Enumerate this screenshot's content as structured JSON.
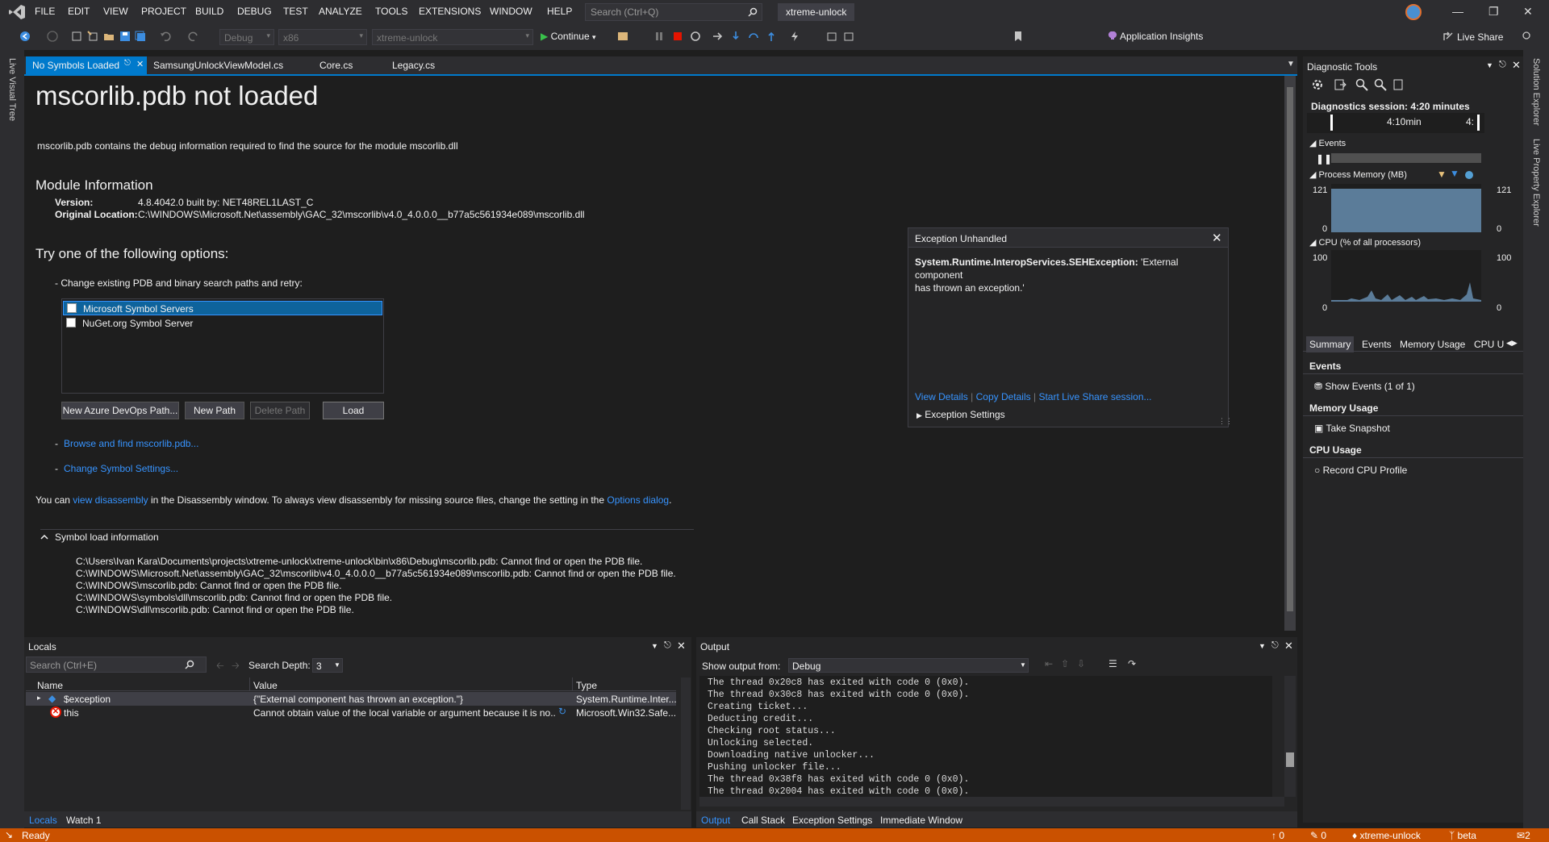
{
  "menu": [
    "FILE",
    "EDIT",
    "VIEW",
    "PROJECT",
    "BUILD",
    "DEBUG",
    "TEST",
    "ANALYZE",
    "TOOLS",
    "EXTENSIONS",
    "WINDOW",
    "HELP"
  ],
  "search_placeholder": "Search (Ctrl+Q)",
  "solution_name": "xtreme-unlock",
  "toolbar": {
    "config": "Debug",
    "platform": "x86",
    "startup": "xtreme-unlock",
    "continue_label": "Continue",
    "app_insights": "Application Insights",
    "live_share": "Live Share"
  },
  "left_strip": "Live Visual Tree",
  "right_strip": [
    "Solution Explorer",
    "Live Property Explorer"
  ],
  "tabs": [
    {
      "label": "No Symbols Loaded"
    },
    {
      "label": "SamsungUnlockViewModel.cs"
    },
    {
      "label": "Core.cs"
    },
    {
      "label": "Legacy.cs"
    }
  ],
  "doc": {
    "title": "mscorlib.pdb not loaded",
    "description": "mscorlib.pdb contains the debug information required to find the source for the module mscorlib.dll",
    "module_heading": "Module Information",
    "version_label": "Version:",
    "version_value": "4.8.4042.0 built by: NET48REL1LAST_C",
    "location_label": "Original Location:",
    "location_value": "C:\\WINDOWS\\Microsoft.Net\\assembly\\GAC_32\\mscorlib\\v4.0_4.0.0.0__b77a5c561934e089\\mscorlib.dll",
    "options_heading": "Try one of the following options:",
    "option_change": "- Change existing PDB and binary search paths and retry:",
    "servers": [
      "Microsoft Symbol Servers",
      "NuGet.org Symbol Server"
    ],
    "buttons": {
      "azure": "New Azure DevOps Path...",
      "new_path": "New Path",
      "delete_path": "Delete Path",
      "load": "Load"
    },
    "browse_dash": "-",
    "browse_link": "Browse and find mscorlib.pdb...",
    "settings_dash": "-",
    "settings_link": "Change Symbol Settings...",
    "disasm_pre": "You can ",
    "disasm_link": "view disassembly",
    "disasm_mid": " in the Disassembly window. To always view disassembly for missing source files, change the setting in the ",
    "disasm_link2": "Options dialog",
    "disasm_post": ".",
    "symbol_heading": "Symbol load information",
    "symbol_lines": [
      "C:\\Users\\Ivan Kara\\Documents\\projects\\xtreme-unlock\\xtreme-unlock\\bin\\x86\\Debug\\mscorlib.pdb: Cannot find or open the PDB file.",
      "C:\\WINDOWS\\Microsoft.Net\\assembly\\GAC_32\\mscorlib\\v4.0_4.0.0.0__b77a5c561934e089\\mscorlib.pdb: Cannot find or open the PDB file.",
      "C:\\WINDOWS\\mscorlib.pdb: Cannot find or open the PDB file.",
      "C:\\WINDOWS\\symbols\\dll\\mscorlib.pdb: Cannot find or open the PDB file.",
      "C:\\WINDOWS\\dll\\mscorlib.pdb: Cannot find or open the PDB file."
    ]
  },
  "exception": {
    "title": "Exception Unhandled",
    "type": "System.Runtime.InteropServices.SEHException:",
    "message_a": " 'External component",
    "message_b": "has thrown an exception.'",
    "links": [
      "View Details",
      "Copy Details",
      "Start Live Share session..."
    ],
    "settings": "Exception Settings"
  },
  "diag": {
    "title": "Diagnostic Tools",
    "session": "Diagnostics session: 4:20 minutes",
    "timeline_a": "4:10min",
    "timeline_b": "4:",
    "events_label": "Events",
    "memory_label": "Process Memory (MB)",
    "mem_max": "121",
    "mem_min": "0",
    "cpu_label": "CPU (% of all processors)",
    "cpu_max": "100",
    "cpu_min": "0",
    "tabs": [
      "Summary",
      "Events",
      "Memory Usage",
      "CPU U"
    ],
    "sections": [
      {
        "heading": "Events",
        "action": "Show Events (1 of 1)"
      },
      {
        "heading": "Memory Usage",
        "action": "Take Snapshot"
      },
      {
        "heading": "CPU Usage",
        "action": "Record CPU Profile"
      }
    ]
  },
  "locals": {
    "title": "Locals",
    "search_placeholder": "Search (Ctrl+E)",
    "depth_label": "Search Depth:",
    "depth_value": "3",
    "columns": [
      "Name",
      "Value",
      "Type"
    ],
    "rows": [
      {
        "name": "$exception",
        "value": "{\"External component has thrown an exception.\"}",
        "type": "System.Runtime.Inter..."
      },
      {
        "name": "this",
        "value": "Cannot obtain value of the local variable or argument because it is no...",
        "type": "Microsoft.Win32.Safe..."
      }
    ],
    "bottom_tabs": [
      "Locals",
      "Watch 1"
    ]
  },
  "output": {
    "title": "Output",
    "show_from_label": "Show output from:",
    "show_from_value": "Debug",
    "lines": [
      "The thread 0x20c8 has exited with code 0 (0x0).",
      "The thread 0x30c8 has exited with code 0 (0x0).",
      "Creating ticket...",
      "Deducting credit...",
      "Checking root status...",
      "Unlocking selected.",
      "Downloading native unlocker...",
      "Pushing unlocker file...",
      "The thread 0x38f8 has exited with code 0 (0x0).",
      "The thread 0x2004 has exited with code 0 (0x0)."
    ],
    "bottom_tabs": [
      "Output",
      "Call Stack",
      "Exception Settings",
      "Immediate Window"
    ]
  },
  "status": {
    "text": "Ready",
    "up": "0",
    "pencil": "0",
    "repo": "xtreme-unlock",
    "branch": "beta",
    "bell": "2"
  },
  "colors": {
    "accent": "#007acc",
    "status": "#ca5100",
    "link": "#3794ff",
    "selection": "#0e639c"
  }
}
